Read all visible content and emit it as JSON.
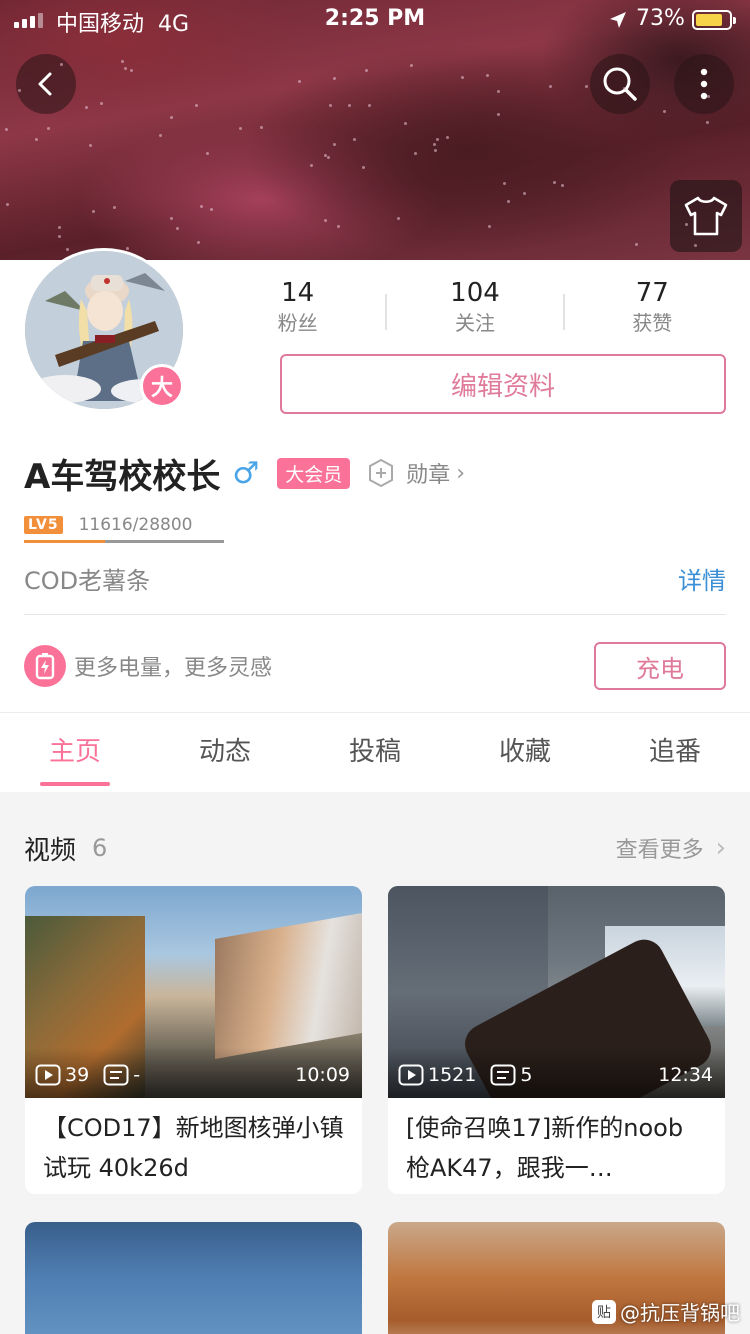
{
  "status_bar": {
    "carrier": "中国移动",
    "network": "4G",
    "time": "2:25 PM",
    "battery_percent": "73%",
    "battery_level": 0.73,
    "battery_color": "#f6d348"
  },
  "header": {
    "back_icon": "chevron-left-icon",
    "search_icon": "search-icon",
    "more_icon": "more-vertical-icon",
    "theme_icon": "tshirt-icon"
  },
  "profile": {
    "avatar_badge": "大",
    "stats": [
      {
        "value": "14",
        "label": "粉丝"
      },
      {
        "value": "104",
        "label": "关注"
      },
      {
        "value": "77",
        "label": "获赞"
      }
    ],
    "edit_button": "编辑资料",
    "username": "A车驾校校长",
    "gender_symbol": "♂",
    "vip_tag": "大会员",
    "medal_label": "勋章",
    "medal_arrow": "›",
    "level_badge": "LV5",
    "exp_text": "11616/28800",
    "exp_progress": 0.4033,
    "signature": "COD老薯条",
    "detail_link": "详情",
    "charge_text": "更多电量，更多灵感",
    "charge_button": "充电"
  },
  "tabs": [
    {
      "label": "主页",
      "active": true
    },
    {
      "label": "动态",
      "active": false
    },
    {
      "label": "投稿",
      "active": false
    },
    {
      "label": "收藏",
      "active": false
    },
    {
      "label": "追番",
      "active": false
    }
  ],
  "videos_section": {
    "title": "视频",
    "count": "6",
    "more_label": "查看更多",
    "more_arrow": "›",
    "videos": [
      {
        "plays": "39",
        "comments": "-",
        "duration": "10:09",
        "title": "【COD17】新地图核弹小镇试玩  40k26d"
      },
      {
        "plays": "1521",
        "comments": "5",
        "duration": "12:34",
        "title": "[使命召唤17]新作的noob枪AK47，跟我一…"
      }
    ]
  },
  "watermark": {
    "icon_text": "贴",
    "text": "@抗压背锅吧"
  },
  "colors": {
    "accent": "#fb7299",
    "link": "#3a8fd6",
    "level": "#f28f3b"
  }
}
